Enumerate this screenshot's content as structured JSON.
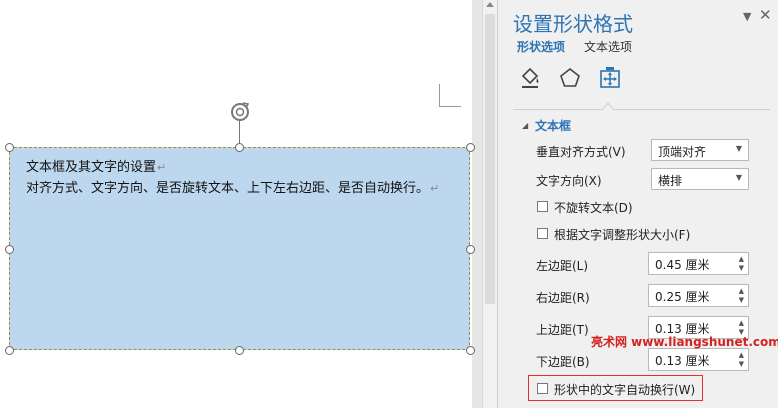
{
  "document": {
    "textbox_lines": [
      "文本框及其文字的设置",
      "对齐方式、文字方向、是否旋转文本、上下左右边距、是否自动换行。"
    ],
    "paragraph_mark": "↵"
  },
  "pane": {
    "title": "设置形状格式",
    "menu_icon": "▼",
    "close_icon": "✕",
    "tabs": {
      "shape_options": "形状选项",
      "text_options": "文本选项"
    },
    "section": {
      "arrow": "◢",
      "title": "文本框"
    },
    "vertical_align": {
      "label": "垂直对齐方式(V)",
      "value": "顶端对齐"
    },
    "text_direction": {
      "label": "文字方向(X)",
      "value": "横排"
    },
    "no_rotate_text": {
      "label": "不旋转文本(D)",
      "checked": false
    },
    "resize_shape": {
      "label": "根据文字调整形状大小(F)",
      "checked": false
    },
    "margins": {
      "left": {
        "label": "左边距(L)",
        "value": "0.45 厘米"
      },
      "right": {
        "label": "右边距(R)",
        "value": "0.25 厘米"
      },
      "top": {
        "label": "上边距(T)",
        "value": "0.13 厘米"
      },
      "bottom": {
        "label": "下边距(B)",
        "value": "0.13 厘米"
      }
    },
    "wrap_text": {
      "label": "形状中的文字自动换行(W)",
      "checked": false
    },
    "dropdown_arrow": "▼",
    "spin_up": "▲",
    "spin_down": "▼"
  },
  "watermark": "亮术网 www.liangshunet.com",
  "colors": {
    "accent": "#2e74b5",
    "textbox_fill": "#bdd7ee",
    "highlight": "#e03030"
  }
}
